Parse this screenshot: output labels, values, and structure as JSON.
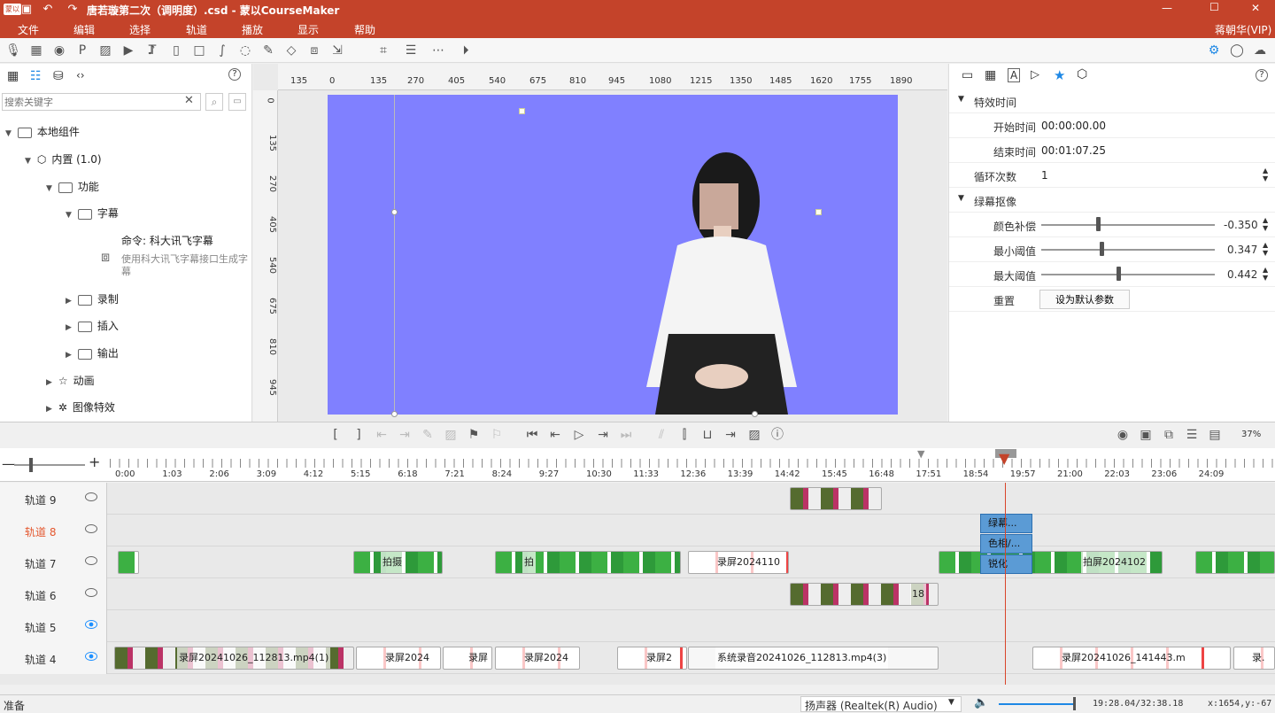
{
  "titlebar": {
    "app_icon": "蒙以",
    "title": "唐若璇第二次（调明度）.csd - 蒙以CourseMaker",
    "minimize": "—",
    "maximize": "☐",
    "close": "✕"
  },
  "menu": {
    "items": [
      "文件",
      "编辑",
      "选择",
      "轨道",
      "播放",
      "显示",
      "帮助"
    ],
    "user": "蒋朝华(VIP)"
  },
  "toolbar": {
    "icons": [
      "mic-icon",
      "screen-record-icon",
      "camera-icon",
      "ppt-icon",
      "image-icon",
      "video-icon",
      "music-icon",
      "text-icon",
      "rect-icon",
      "doc-icon",
      "curve-icon",
      "lasso-icon",
      "pen-icon",
      "eraser-icon",
      "frame-icon",
      "export-icon",
      "crop-icon",
      "sliders-icon",
      "more-icon",
      "play-circle-icon"
    ],
    "right_icons": [
      "gear-icon",
      "chat-icon",
      "cloud-icon"
    ]
  },
  "leftpanel": {
    "search_placeholder": "搜索关键字",
    "help": "?",
    "tree": {
      "root": "本地组件",
      "builtin": "内置 (1.0)",
      "function": "功能",
      "subtitle": "字幕",
      "cmd_title": "命令: 科大讯飞字幕",
      "cmd_desc": "使用科大讯飞字幕接口生成字幕",
      "record": "录制",
      "insert": "插入",
      "output": "输出",
      "animation": "动画",
      "effects": "图像特效"
    }
  },
  "hruler": [
    "135",
    "0",
    "135",
    "270",
    "405",
    "540",
    "675",
    "810",
    "945",
    "1080",
    "1215",
    "1350",
    "1485",
    "1620",
    "1755",
    "1890"
  ],
  "vruler": [
    "0",
    "135",
    "270",
    "405",
    "540",
    "675",
    "810",
    "945"
  ],
  "rightpanel": {
    "help": "?",
    "section_time": "特效时间",
    "start_label": "开始时间",
    "start_value": "00:00:00.00",
    "end_label": "结束时间",
    "end_value": "00:01:07.25",
    "loop_label": "循环次数",
    "loop_value": "1",
    "section_chroma": "绿幕抠像",
    "color_label": "颜色补偿",
    "color_value": "-0.350",
    "color_level": 0.325,
    "min_label": "最小阈值",
    "min_value": "0.347",
    "min_level": 0.347,
    "max_label": "最大阈值",
    "max_value": "0.442",
    "max_level": 0.442,
    "reset_label": "重置",
    "reset_button": "设为默认参数"
  },
  "playbar": {
    "zoom": "37%"
  },
  "timeline": {
    "ticks": [
      "0:00",
      "1:03",
      "2:06",
      "3:09",
      "4:12",
      "5:15",
      "6:18",
      "7:21",
      "8:24",
      "9:27",
      "10:30",
      "11:33",
      "12:36",
      "13:39",
      "14:42",
      "15:45",
      "16:48",
      "17:51",
      "18:54",
      "19:57",
      "21:00",
      "22:03",
      "23:06",
      "24:09"
    ],
    "tracks": [
      "轨道 9",
      "轨道 8",
      "轨道 7",
      "轨道 6",
      "轨道 5",
      "轨道 4"
    ],
    "clips": {
      "t7_a": "拍摄",
      "t7_b": "拍",
      "t7_c": "录屏2024110",
      "t7_d": "拍屏2024102",
      "t6_a": "18",
      "t4_a": "录屏20241026_112813.mp4(1)",
      "t4_b": "录屏2024",
      "t4_c": "录屏",
      "t4_d": "录屏2024",
      "t4_e": "录屏2",
      "t4_f": "系统录音20241026_112813.mp4(3)",
      "t4_g": "录屏20241026_141443.m",
      "t4_h": "录."
    },
    "fx": [
      "绿幕...",
      "色相/...",
      "锐化"
    ]
  },
  "status": {
    "ready": "准备",
    "device": "扬声器 (Realtek(R) Audio)",
    "time": "19:28.04/32:38.18",
    "coords": "x:1654,y:-67"
  }
}
